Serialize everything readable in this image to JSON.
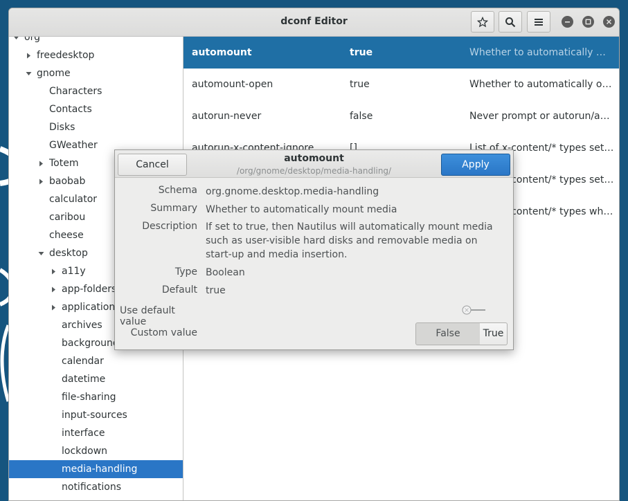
{
  "window": {
    "title": "dconf Editor"
  },
  "header_buttons": [
    {
      "name": "bookmark",
      "icon": "star-icon"
    },
    {
      "name": "search",
      "icon": "search-icon"
    },
    {
      "name": "menu",
      "icon": "hamburger-menu-icon"
    }
  ],
  "tree": [
    {
      "label": "org",
      "arrow": "down",
      "depth": 0
    },
    {
      "label": "freedesktop",
      "arrow": "right",
      "depth": 1
    },
    {
      "label": "gnome",
      "arrow": "down",
      "depth": 1
    },
    {
      "label": "Characters",
      "arrow": "",
      "depth": 2
    },
    {
      "label": "Contacts",
      "arrow": "",
      "depth": 2
    },
    {
      "label": "Disks",
      "arrow": "",
      "depth": 2
    },
    {
      "label": "GWeather",
      "arrow": "",
      "depth": 2
    },
    {
      "label": "Totem",
      "arrow": "right",
      "depth": 2
    },
    {
      "label": "baobab",
      "arrow": "right",
      "depth": 2
    },
    {
      "label": "calculator",
      "arrow": "",
      "depth": 2
    },
    {
      "label": "caribou",
      "arrow": "",
      "depth": 2
    },
    {
      "label": "cheese",
      "arrow": "",
      "depth": 2
    },
    {
      "label": "desktop",
      "arrow": "down",
      "depth": 2
    },
    {
      "label": "a11y",
      "arrow": "right",
      "depth": 3
    },
    {
      "label": "app-folders",
      "arrow": "right",
      "depth": 3
    },
    {
      "label": "applications",
      "arrow": "right",
      "depth": 3
    },
    {
      "label": "archives",
      "arrow": "",
      "depth": 3
    },
    {
      "label": "background",
      "arrow": "",
      "depth": 3
    },
    {
      "label": "calendar",
      "arrow": "",
      "depth": 3
    },
    {
      "label": "datetime",
      "arrow": "",
      "depth": 3
    },
    {
      "label": "file-sharing",
      "arrow": "",
      "depth": 3
    },
    {
      "label": "input-sources",
      "arrow": "",
      "depth": 3
    },
    {
      "label": "interface",
      "arrow": "",
      "depth": 3
    },
    {
      "label": "lockdown",
      "arrow": "",
      "depth": 3
    },
    {
      "label": "media-handling",
      "arrow": "",
      "depth": 3,
      "selected": true
    },
    {
      "label": "notifications",
      "arrow": "",
      "depth": 3
    }
  ],
  "keys": [
    {
      "name": "automount",
      "value": "true",
      "summary": "Whether to automatically mou…",
      "selected": true
    },
    {
      "name": "automount-open",
      "value": "true",
      "summary": "Whether to automatically open…"
    },
    {
      "name": "autorun-never",
      "value": "false",
      "summary": "Never prompt or autorun/autos…"
    },
    {
      "name": "autorun-x-content-ignore",
      "value": "[]",
      "summary": "List of x-content/* types set to…"
    },
    {
      "name": "",
      "value": "",
      "summary": "List of x-content/* types set to…"
    },
    {
      "name": "",
      "value": "",
      "summary": "List of x-content/* types wher…"
    }
  ],
  "dialog": {
    "title": "automount",
    "path": "/org/gnome/desktop/media-handling/",
    "cancel_label": "Cancel",
    "apply_label": "Apply",
    "schema_label": "Schema",
    "schema_value": "org.gnome.desktop.media-handling",
    "summary_label": "Summary",
    "summary_value": "Whether to automatically mount media",
    "description_label": "Description",
    "description_value": "If set to true, then Nautilus will automatically mount media such as user-visible hard disks and removable media on start-up and media insertion.",
    "type_label": "Type",
    "type_value": "Boolean",
    "default_label": "Default",
    "default_value": "true",
    "use_default_label": "Use default value",
    "use_default_on": false,
    "custom_label": "Custom value",
    "false_label": "False",
    "true_label": "True",
    "custom_selected": "False"
  },
  "colors": {
    "accent": "#2a76c6",
    "selected_row": "#1f6fa5",
    "desktop": "#1a5a85"
  }
}
